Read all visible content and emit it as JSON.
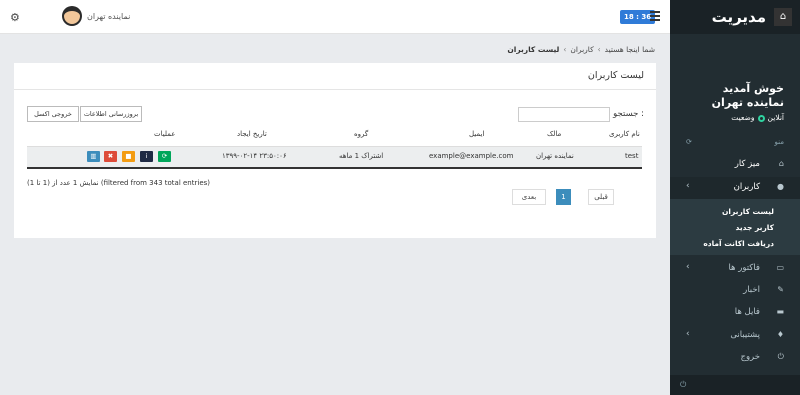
{
  "topbar": {
    "user_name": "نماینده تهران",
    "clock": "18 : 36"
  },
  "sidebar": {
    "brand": "مدیریت",
    "welcome": "خوش آمدید",
    "user": "نماینده تهران",
    "status_label": "وضعیت",
    "status_value": "آنلاین",
    "menu_header": "منو",
    "items": [
      {
        "label": "میز کار",
        "icon": "home-icon"
      },
      {
        "label": "کاربران",
        "icon": "user-icon"
      },
      {
        "label": "فاکتور ها",
        "icon": "invoice-icon"
      },
      {
        "label": "اخبار",
        "icon": "news-icon"
      },
      {
        "label": "فایل ها",
        "icon": "folder-icon"
      },
      {
        "label": "پشتیبانی",
        "icon": "support-icon"
      },
      {
        "label": "خروج",
        "icon": "power-icon"
      }
    ],
    "submenu": [
      "لیست کاربران",
      "کاربر جدید",
      "دریافت اکانت آماده"
    ]
  },
  "breadcrumb": {
    "prefix": "شما اینجا هستید",
    "parent": "کاربران",
    "current": "لیست کاربران"
  },
  "card": {
    "title": "لیست کاربران",
    "search_label": "جستجو :",
    "search_value": "",
    "btn_update": "بروزرسانی اطلاعات",
    "btn_excel": "خروجی اکسل"
  },
  "table": {
    "headers": {
      "username": "نام کاربری",
      "owner": "مالک",
      "email": "ایمیل",
      "group": "گروه",
      "created": "تاریخ ایجاد",
      "actions": "عملیات"
    },
    "row": {
      "username": "test",
      "owner": "نماینده تهران",
      "email": "example@example.com",
      "group": "اشتراک 1 ماهه",
      "created": "۱۳۹۹-۰۲-۱۴ ۲۳:۵۰:۰۶"
    },
    "action_colors": {
      "refresh": "#00a65a",
      "info": "#1f2a44",
      "lock": "#f39c12",
      "delete": "#dd4b39",
      "chart": "#3c8dbc"
    }
  },
  "info": "نمایش 1 عدد از (1 تا 1) (filtered from 343 total entries)",
  "pagination": {
    "prev": "قبلی",
    "page": "1",
    "next": "بعدی"
  }
}
